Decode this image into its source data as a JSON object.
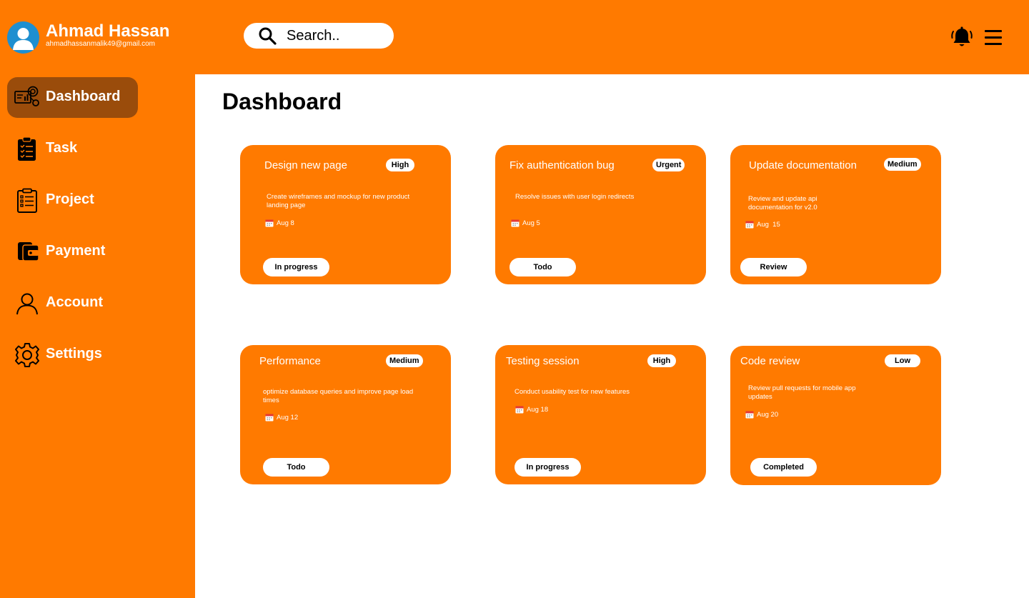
{
  "user": {
    "name": "Ahmad Hassan",
    "email": "ahmadhassanmalik49@gmail.com"
  },
  "search": {
    "placeholder": "Search.."
  },
  "header": {
    "icons": [
      "bell-icon",
      "menu-icon"
    ]
  },
  "sidebar": {
    "items": [
      {
        "label": "Dashboard",
        "icon": "dashboard-icon",
        "active": true
      },
      {
        "label": "Task",
        "icon": "clipboard-icon"
      },
      {
        "label": "Project",
        "icon": "checklist-icon"
      },
      {
        "label": "Payment",
        "icon": "wallet-icon"
      },
      {
        "label": "Account",
        "icon": "user-icon"
      },
      {
        "label": "Settings",
        "icon": "gear-icon"
      }
    ]
  },
  "main": {
    "title": "Dashboard"
  },
  "cards": [
    {
      "title": "Design new page",
      "priority": "High",
      "description": "Create wireframes and mockup for new product landing page",
      "date": "Aug 8",
      "status": "In progress"
    },
    {
      "title": "Fix authentication bug",
      "priority": "Urgent",
      "description": "Resolve issues with user login redirects",
      "date": "Aug 5",
      "status": "Todo"
    },
    {
      "title": "Update documentation",
      "priority": "Medium",
      "description": "Review and update api documentation for v2.0",
      "date": "Aug  15",
      "status": "Review"
    },
    {
      "title": "Performance",
      "priority": "Medium",
      "description": "optimize database queries and improve page load times",
      "date": "Aug 12",
      "status": "Todo"
    },
    {
      "title": "Testing session",
      "priority": "High",
      "description": "Conduct usability test for new features",
      "date": "Aug 18",
      "status": "In progress"
    },
    {
      "title": "Code review",
      "priority": "Low",
      "description": "Review pull requests for mobile app updates",
      "date": "Aug 20",
      "status": "Completed"
    }
  ],
  "colors": {
    "accent": "#FF7A00",
    "active_nav": "#9A4C0B",
    "avatar": "#1E8FD0"
  }
}
